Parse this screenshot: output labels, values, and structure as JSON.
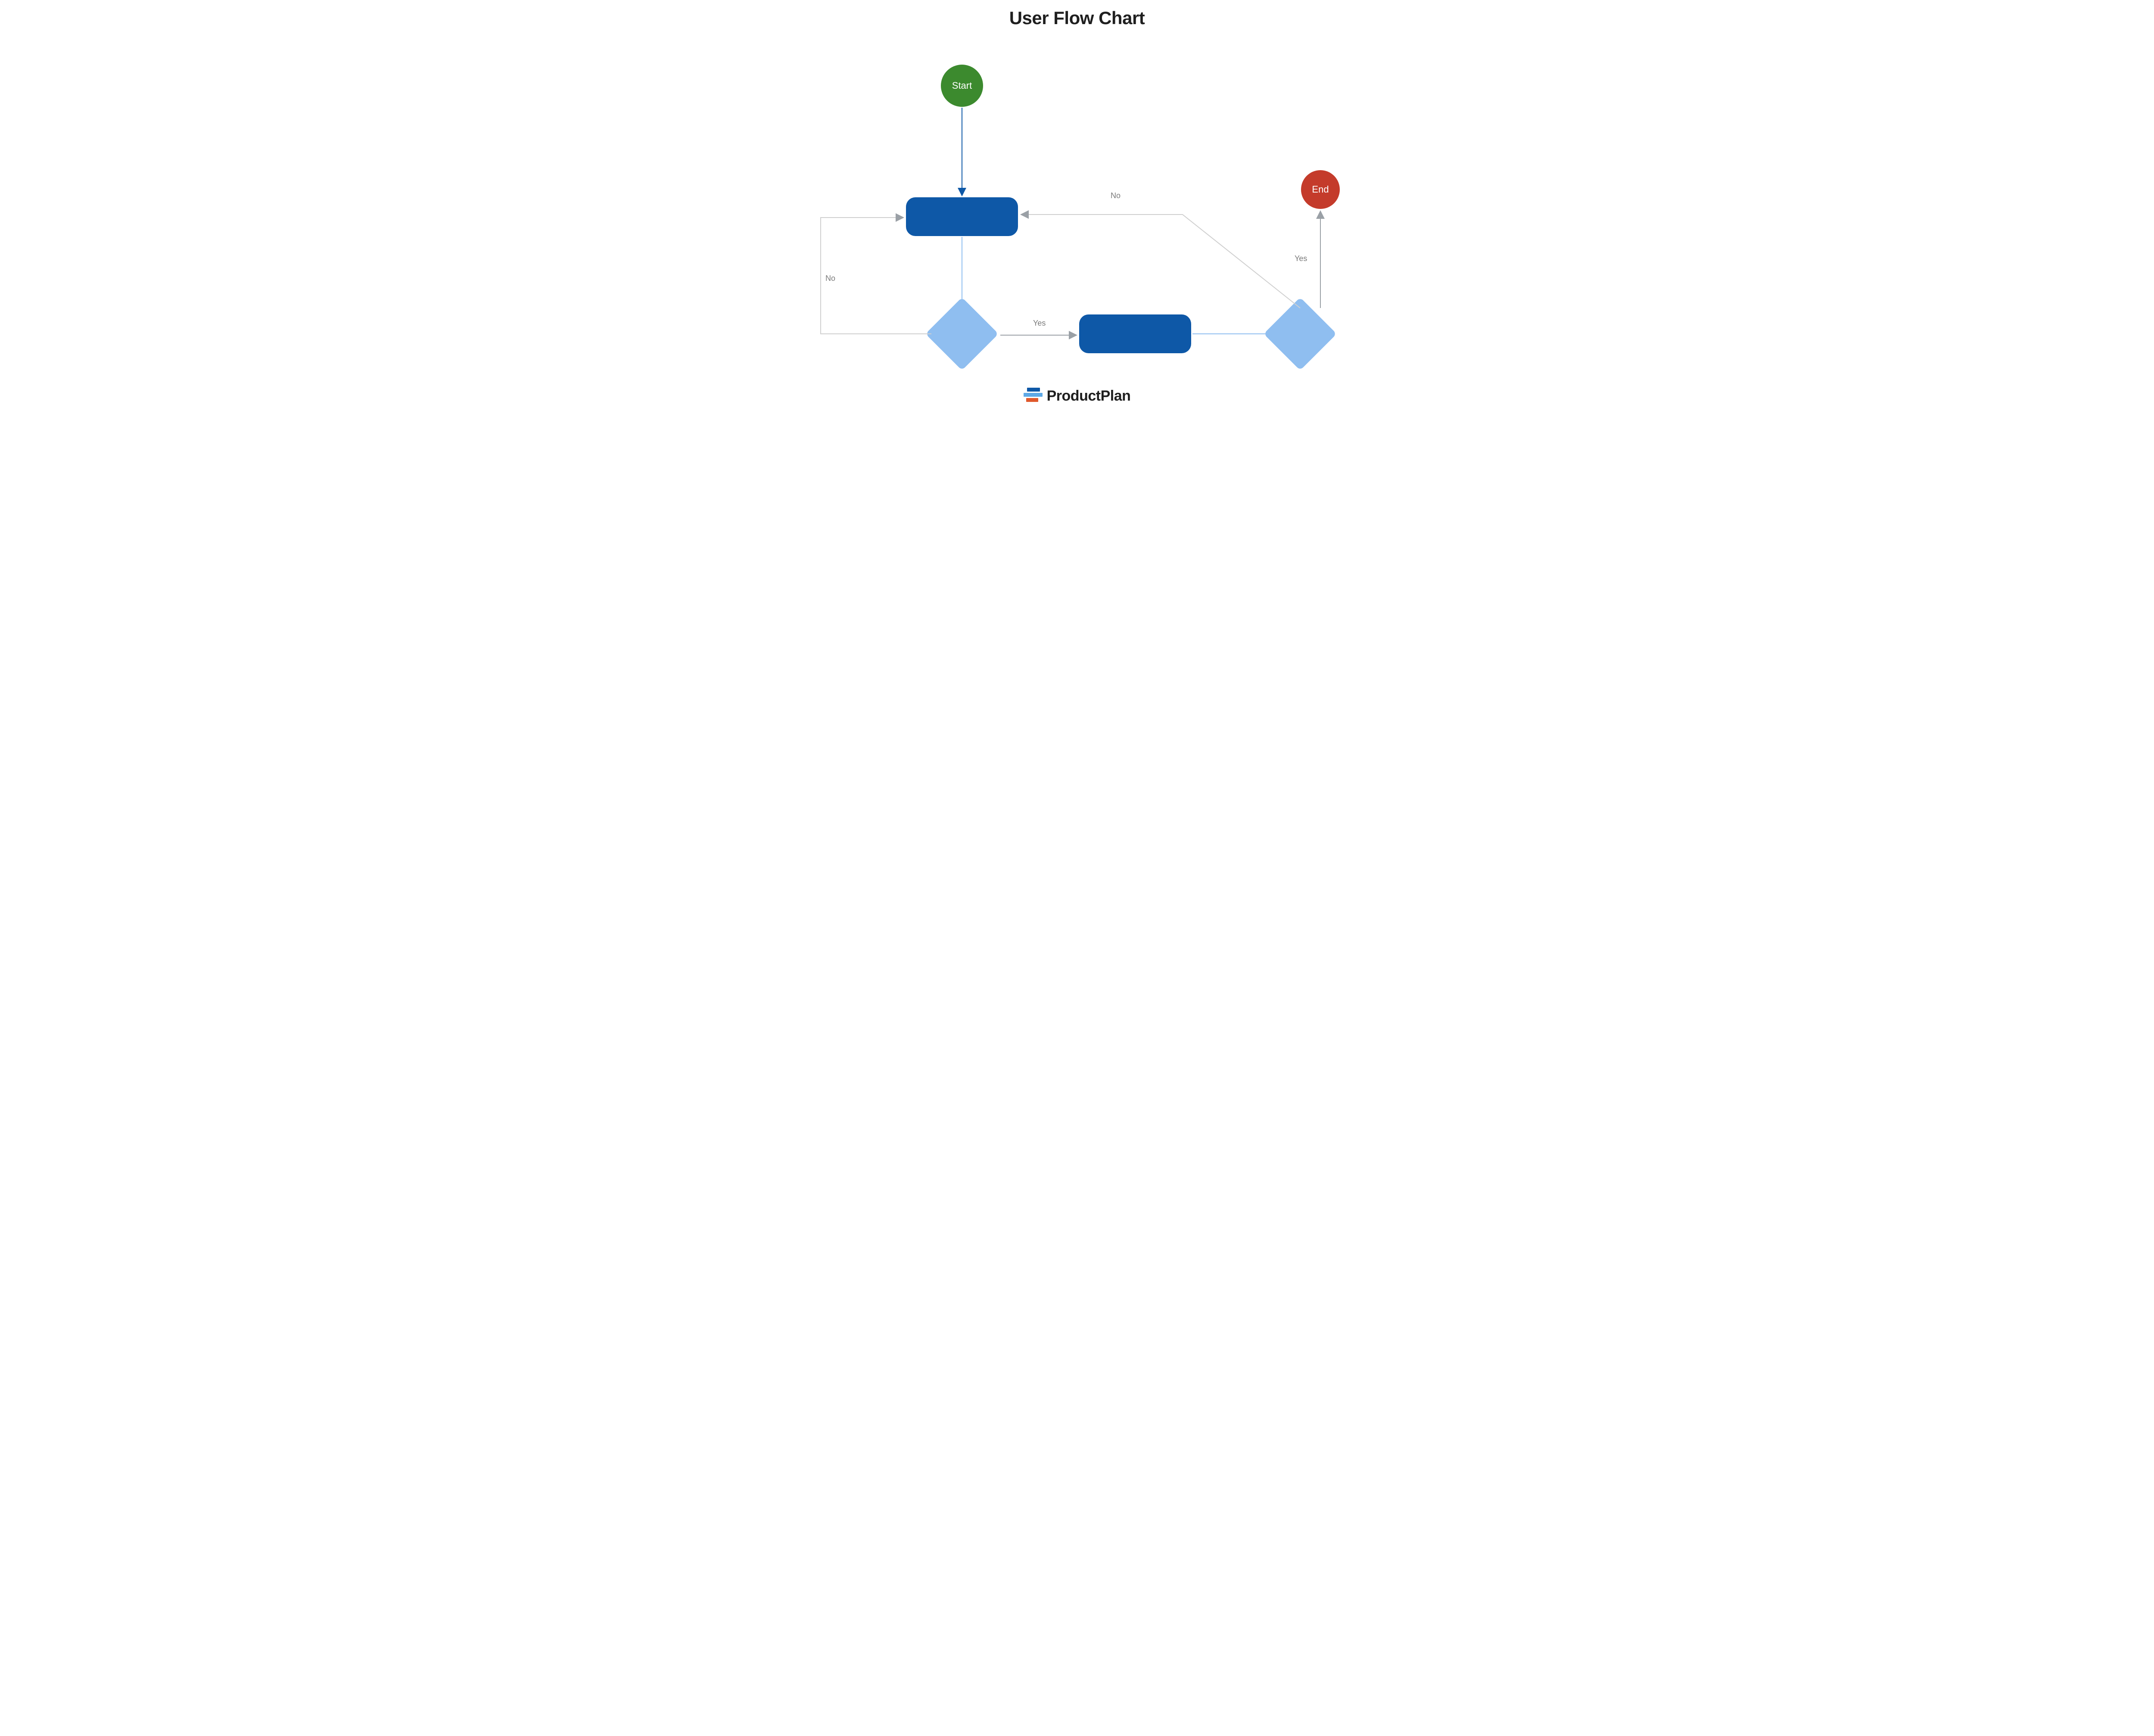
{
  "title": "User Flow Chart",
  "nodes": {
    "start_label": "Start",
    "end_label": "End"
  },
  "edges": {
    "no1": "No",
    "yes1": "Yes",
    "no2": "No",
    "yes2": "Yes"
  },
  "brand": "ProductPlan",
  "colors": {
    "start": "#3c8a2e",
    "end": "#c43b2b",
    "process": "#0e58a7",
    "decision": "#8fbef0",
    "edge": "#9aa0a6",
    "arrow_primary": "#0e58a7"
  }
}
